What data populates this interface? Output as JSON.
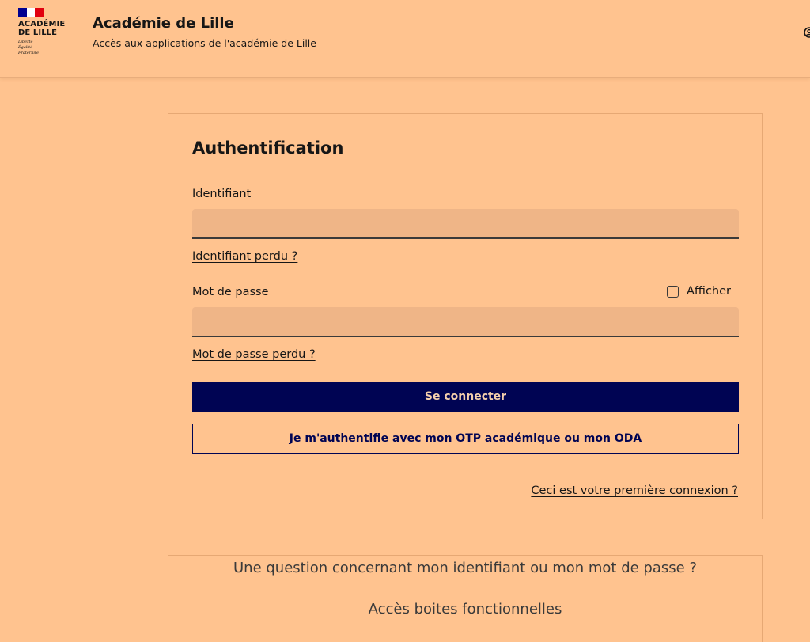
{
  "header": {
    "logo_name": "ACADÉMIE DE LILLE",
    "logo_motto": [
      "Liberté",
      "Égalité",
      "Fraternité"
    ],
    "title": "Académie de Lille",
    "tagline": "Accès aux applications de l'académie de Lille",
    "account_icon": "account-icon"
  },
  "auth": {
    "title": "Authentification",
    "username_label": "Identifiant",
    "username_value": "",
    "username_lost": "Identifiant perdu ?",
    "password_label": "Mot de passe",
    "password_value": "",
    "show_label": "Afficher",
    "show_checked": false,
    "password_lost": "Mot de passe perdu ?",
    "login_button": "Se connecter",
    "otp_button": "Je m'authentifie avec mon OTP académique ou mon ODA",
    "first_login": "Ceci est votre première connexion ?"
  },
  "help": {
    "question_link": "Une question concernant mon identifiant ou mon mot de passe ?",
    "boxes_link": "Accès boites fonctionnelles"
  },
  "colors": {
    "background": "#ffc38f",
    "primary": "#000453",
    "input_bg": "#efb587"
  }
}
